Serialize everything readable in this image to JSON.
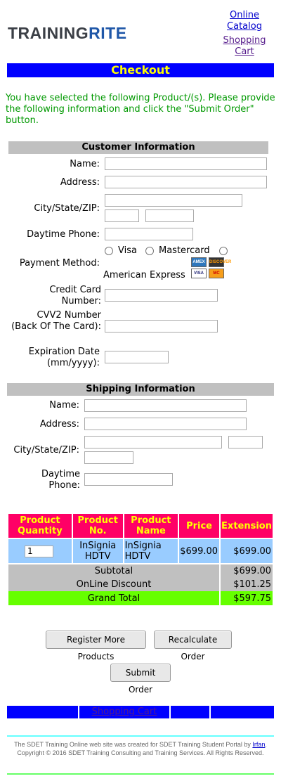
{
  "header": {
    "logo_main": "TRAINING",
    "logo_accent": "RITE",
    "links": [
      "Online Catalog",
      "Shopping Cart"
    ]
  },
  "page_title": "Checkout",
  "intro": "You have selected the following Product/(s). Please provide the following information and click the \"Submit Order\" button.",
  "customer": {
    "heading": "Customer Information",
    "name_label": "Name:",
    "address_label": "Address:",
    "csz_label": "City/State/ZIP:",
    "phone_label": "Daytime Phone:",
    "payment_label": "Payment Method:",
    "payment_options": [
      "Visa",
      "Mastercard",
      "American Express"
    ],
    "cc_label": "Credit Card Number:",
    "cvv_label": "CVV2 Number (Back Of The Card):",
    "exp_label": "Expiration Date (mm/yyyy):",
    "card_icons": [
      "AMEX",
      "DISCOVER",
      "VISA",
      "MC"
    ]
  },
  "shipping": {
    "heading": "Shipping Information",
    "name_label": "Name:",
    "address_label": "Address:",
    "csz_label": "City/State/ZIP:",
    "phone_label": "Daytime Phone:"
  },
  "order": {
    "headers": [
      "Product Quantity",
      "Product No.",
      "Product Name",
      "Price",
      "Extension"
    ],
    "item": {
      "quantity": "1",
      "product_no": "InSignia HDTV",
      "product_name": "InSignia HDTV",
      "price": "$699.00",
      "extension": "$699.00"
    },
    "subtotal_label": "Subtotal",
    "subtotal": "$699.00",
    "discount_label": "OnLine Discount",
    "discount": "$101.25",
    "grand_total_label": "Grand Total",
    "grand_total": "$597.75"
  },
  "buttons": {
    "register": "Register More Products",
    "recalculate": "Recalculate Order",
    "submit": "Submit Order"
  },
  "nav": {
    "cart_link": "Shopping Cart"
  },
  "footer": {
    "text_before": "The SDET Training Online web site was created for SDET Training Student Portal by ",
    "author": "Irfan",
    "text_after": ". Copyright © 2016 SDET Training Consulting and Training Services. All Rights Reserved."
  },
  "colors": {
    "title_bar": "#0000ff",
    "title_text": "#ffff00",
    "intro_text": "#009900",
    "table_header": "#ff0066",
    "item_row": "#99ccff",
    "grand_total": "#66ff00",
    "footer_line": "#66ff66"
  }
}
